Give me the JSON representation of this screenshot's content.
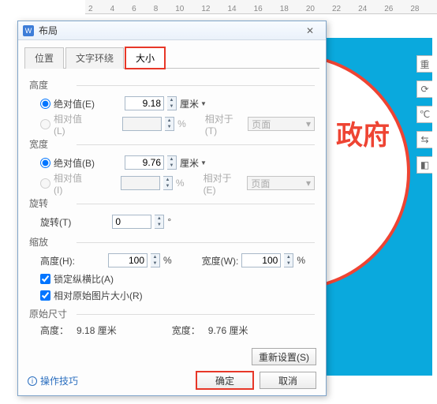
{
  "ruler": [
    "2",
    "4",
    "6",
    "8",
    "10",
    "12",
    "14",
    "16",
    "18",
    "20",
    "22",
    "24",
    "26",
    "28"
  ],
  "stamp_text": "政府",
  "side_icons": [
    "重",
    "⟳",
    "℃",
    "⇆",
    "◧"
  ],
  "dialog": {
    "title": "布局",
    "close": "✕",
    "tabs": {
      "pos": "位置",
      "wrap": "文字环绕",
      "size": "大小"
    },
    "height": {
      "label": "高度",
      "abs": "绝对值(E)",
      "abs_val": "9.18",
      "unit": "厘米",
      "rel": "相对值(L)",
      "rel_val": "",
      "pct": "%",
      "rel_to": "相对于(T)",
      "page": "页面"
    },
    "width": {
      "label": "宽度",
      "abs": "绝对值(B)",
      "abs_val": "9.76",
      "unit": "厘米",
      "rel": "相对值(I)",
      "rel_val": "",
      "pct": "%",
      "rel_to": "相对于(E)",
      "page": "页面"
    },
    "rotate": {
      "label": "旋转",
      "field": "旋转(T)",
      "val": "0",
      "deg": "°"
    },
    "scale": {
      "label": "缩放",
      "h": "高度(H):",
      "h_val": "100",
      "w": "宽度(W):",
      "w_val": "100",
      "pct": "%",
      "lock": "锁定纵横比(A)",
      "orig": "相对原始图片大小(R)"
    },
    "original": {
      "label": "原始尺寸",
      "h": "高度：",
      "h_val": "9.18 厘米",
      "w": "宽度：",
      "w_val": "9.76 厘米"
    },
    "reset": "重新设置(S)",
    "ok": "确定",
    "cancel": "取消",
    "tips": "操作技巧"
  }
}
